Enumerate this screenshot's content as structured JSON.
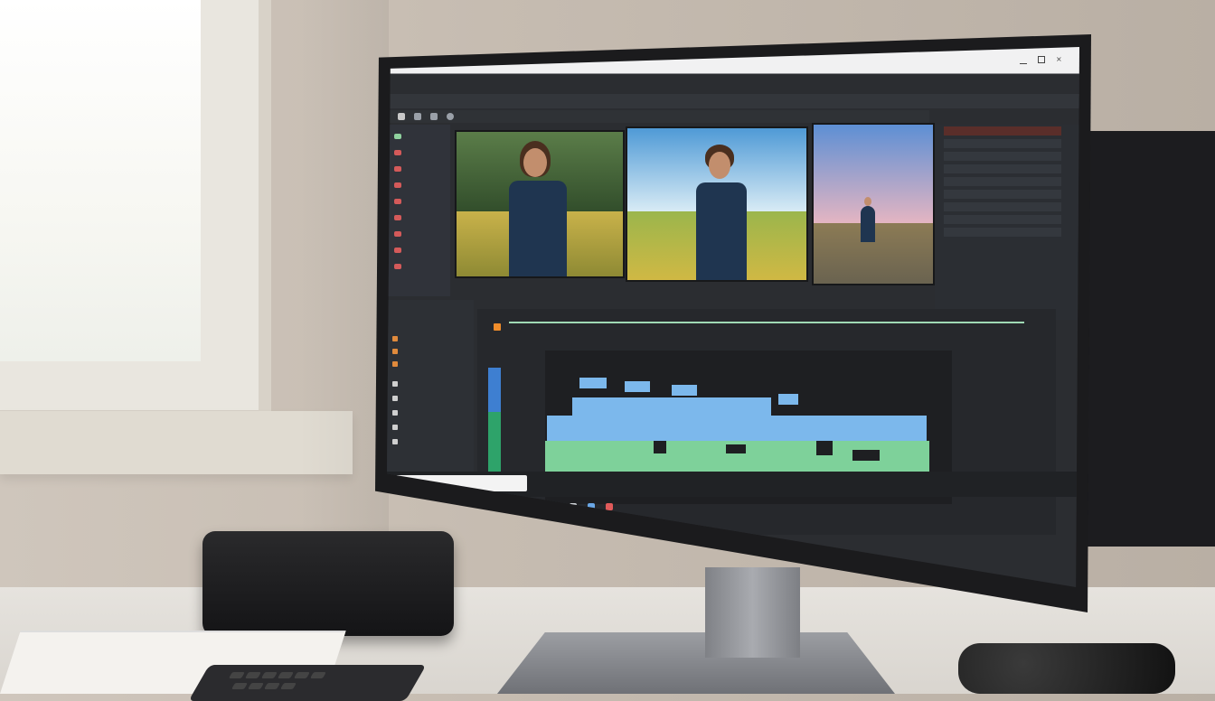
{
  "scene": {
    "description_free": true
  },
  "editor": {
    "title_bar_text": "",
    "menu_items": [
      "",
      "",
      "",
      "",
      ""
    ],
    "clips": [
      {
        "caption": "",
        "scene": "forest"
      },
      {
        "caption": "",
        "scene": "meadow"
      },
      {
        "caption": "",
        "scene": "mountain-road"
      }
    ],
    "right_panel_items": [
      "",
      "",
      "",
      "",
      "",
      "",
      "",
      "",
      ""
    ],
    "search_placeholder": "",
    "tray_text": ""
  },
  "colors": {
    "accent_orange": "#f08d2b",
    "waveform_blue": "#7cb8ec",
    "waveform_green": "#7ed19a",
    "timeline_line": "#9fd9b4",
    "selection_red": "#5a2e2a"
  },
  "icons": [
    "play-icon",
    "scissors-icon",
    "folder-icon",
    "settings-icon",
    "close-icon",
    "minimize-icon",
    "maximize-icon"
  ]
}
